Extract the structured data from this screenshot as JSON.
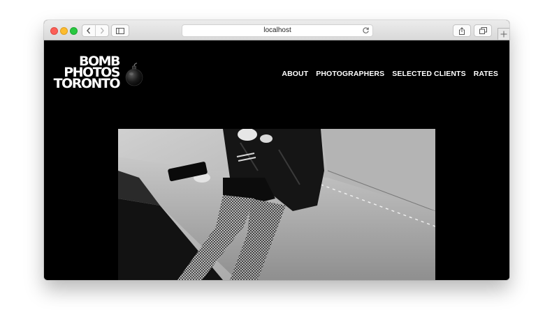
{
  "browser": {
    "url": "localhost",
    "icons": [
      "back-icon",
      "forward-icon",
      "sidebar-icon",
      "reload-icon",
      "share-icon",
      "tabs-icon",
      "new-tab-icon"
    ]
  },
  "site": {
    "logo": {
      "line1": "BOMB",
      "line2": "PHOTOS",
      "line3": "TORONTO"
    },
    "nav": [
      "ABOUT",
      "PHOTOGRAPHERS",
      "SELECTED CLIENTS",
      "RATES"
    ]
  },
  "colors": {
    "background": "#000000",
    "text": "#ffffff",
    "chrome": "#e3e3e3"
  }
}
